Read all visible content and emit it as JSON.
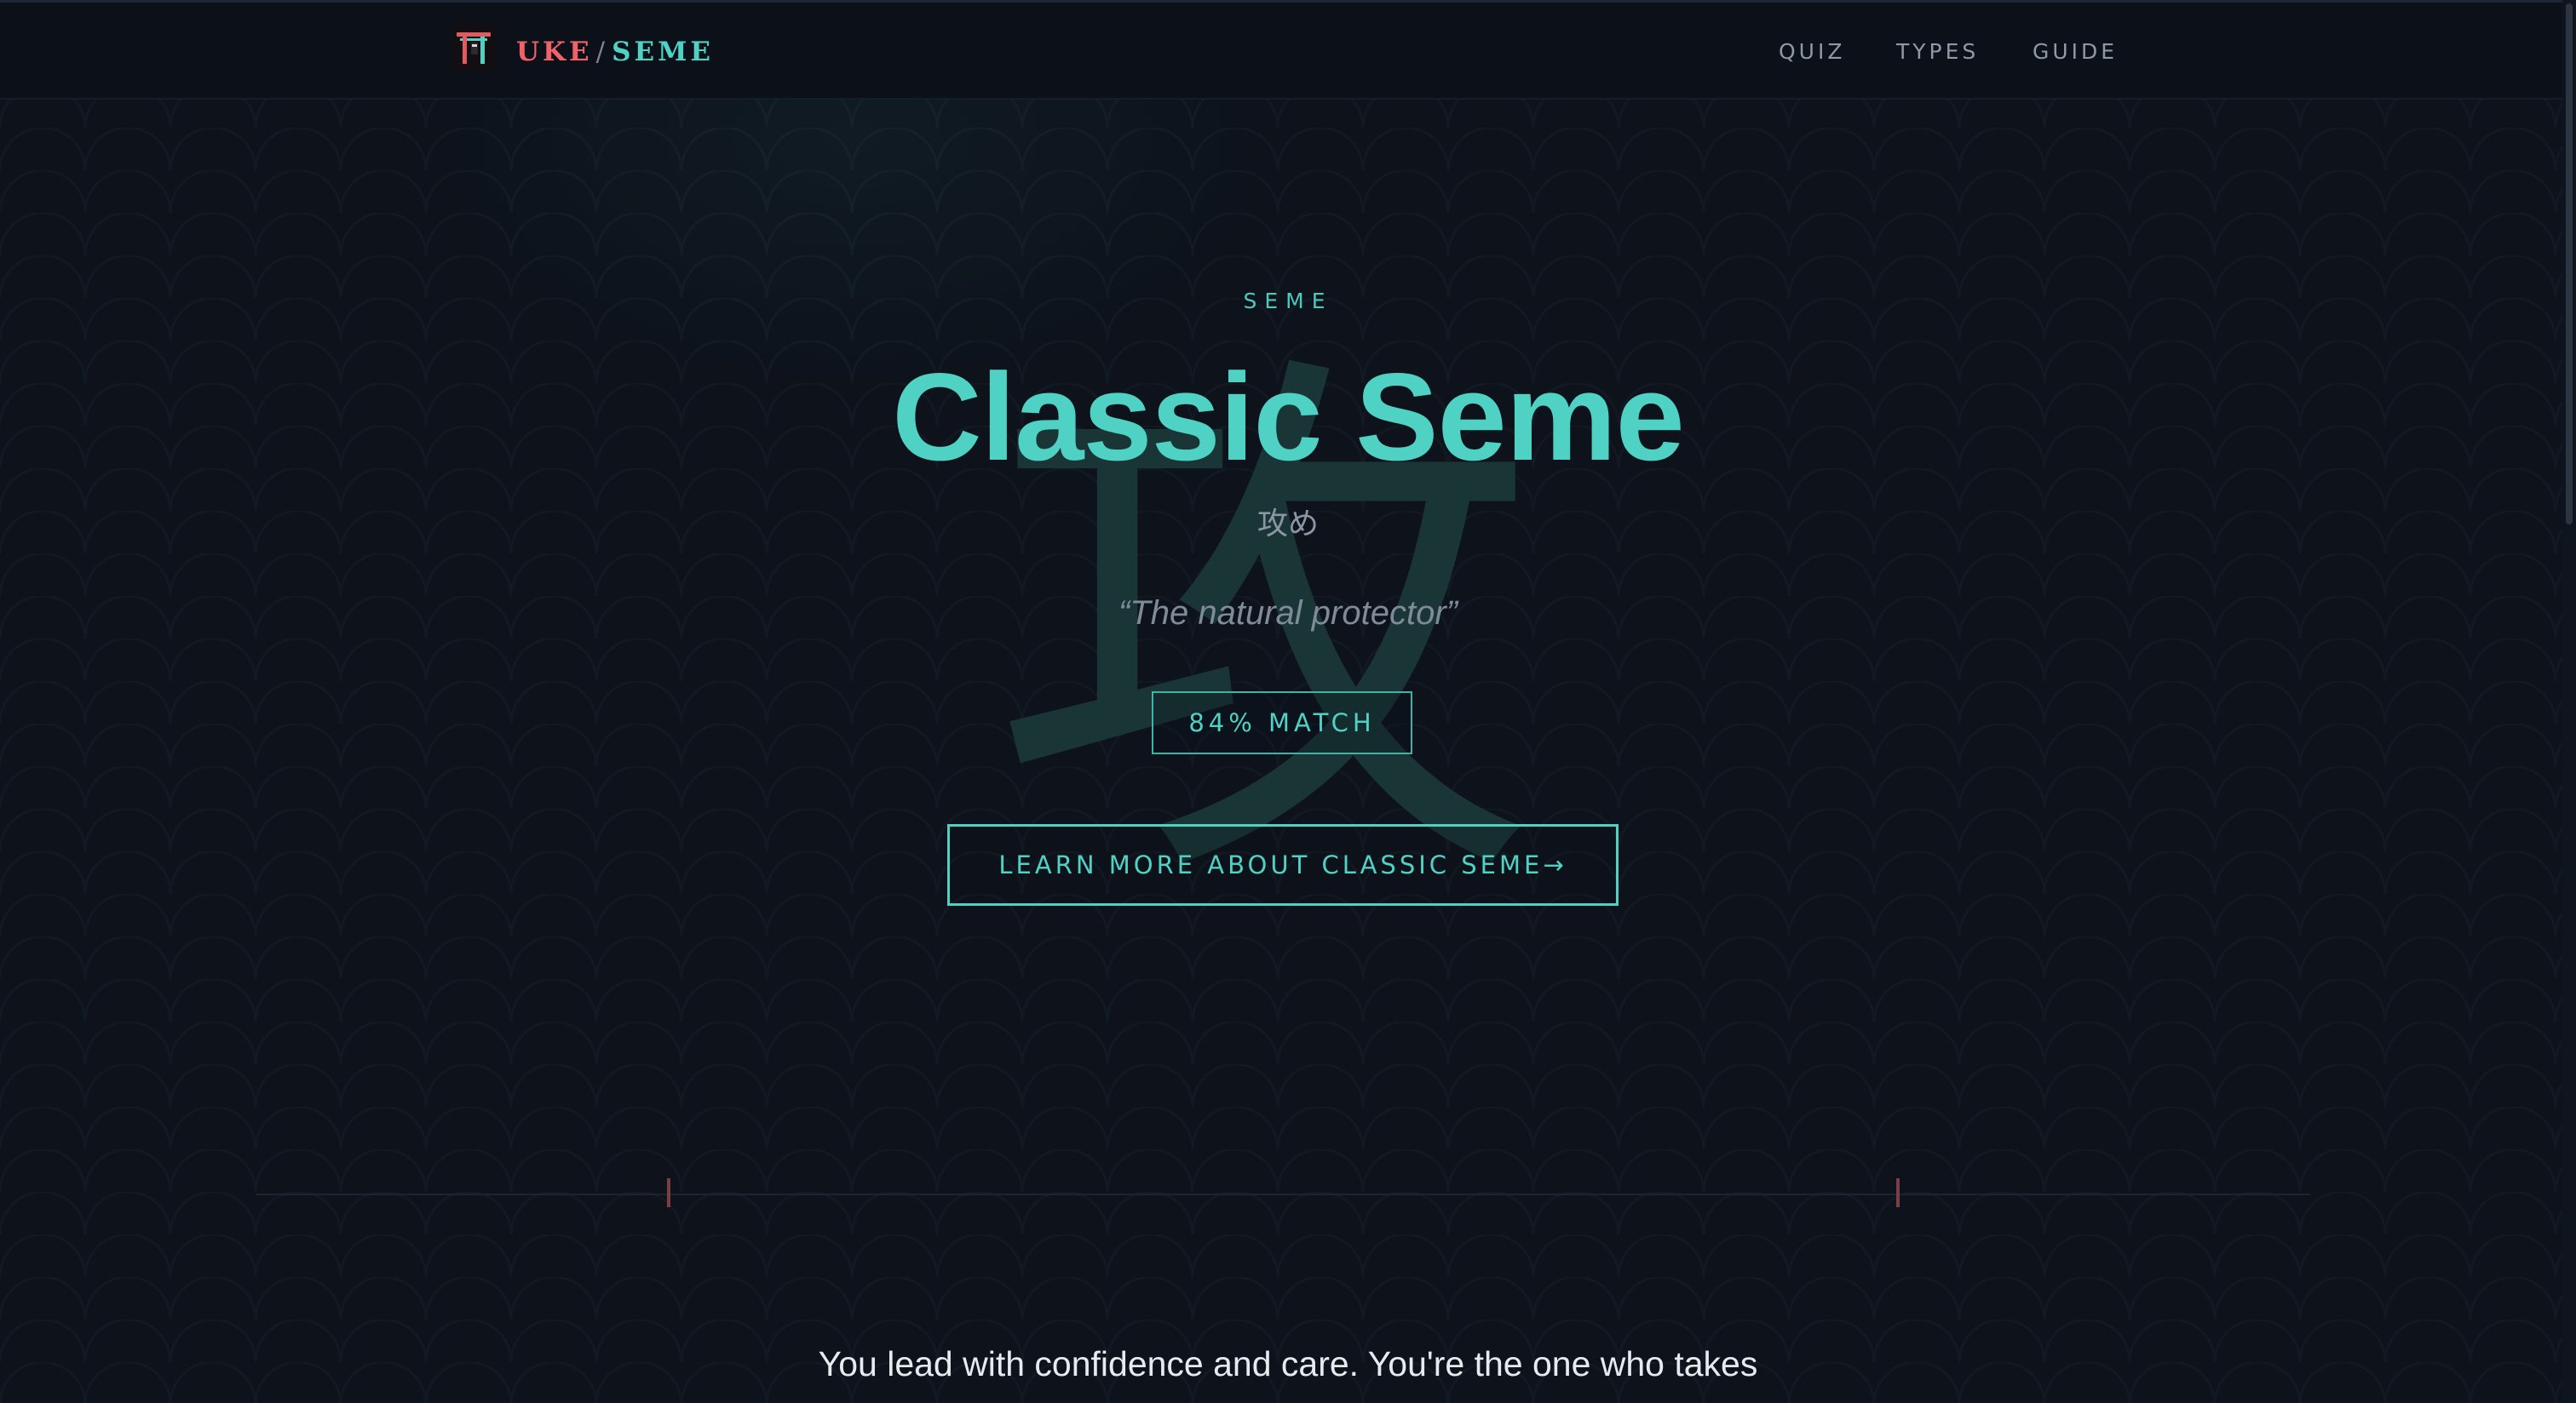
{
  "header": {
    "brand_uke": "UKE",
    "brand_slash": "/",
    "brand_seme": "SEME",
    "nav": {
      "quiz": "QUIZ",
      "types": "TYPES",
      "guide": "GUIDE"
    }
  },
  "hero": {
    "kanji": "攻",
    "eyebrow": "SEME",
    "title": "Classic Seme",
    "japanese": "攻め",
    "tagline": "“The natural protector”",
    "match": "84% MATCH",
    "cta": "LEARN MORE ABOUT CLASSIC SEME→"
  },
  "body": {
    "description": "You lead with confidence and care. You're the one who takes"
  },
  "colors": {
    "background": "#0d121b",
    "accent_teal": "#4fd2c4",
    "accent_coral": "#f0626a",
    "muted_text": "#8e99a8"
  },
  "icons": {
    "logo": "torii-gate-logo-icon"
  }
}
